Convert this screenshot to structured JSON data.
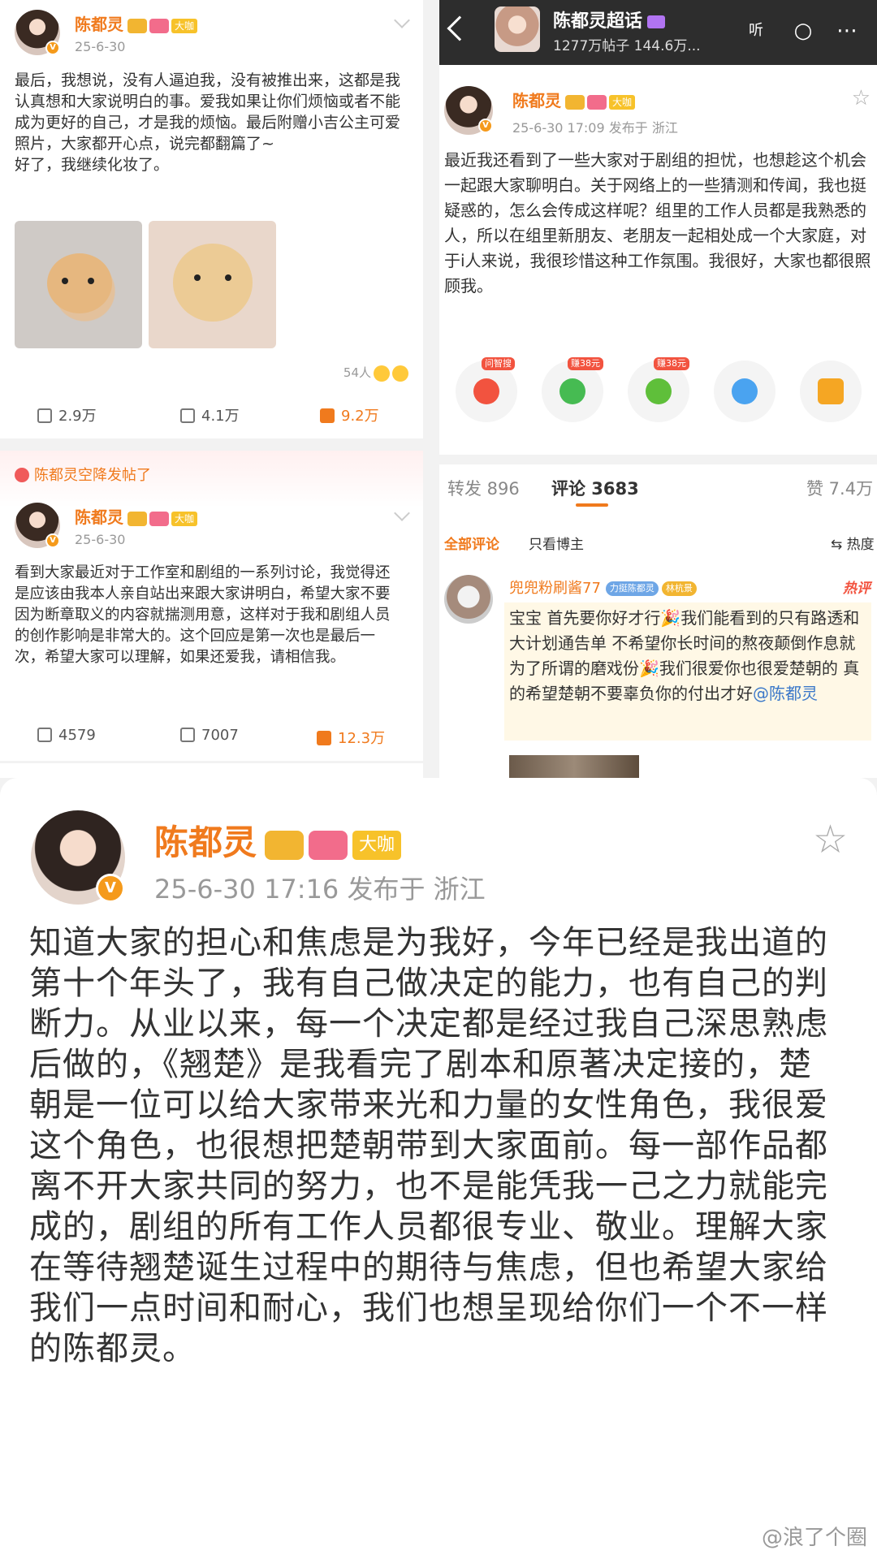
{
  "left": {
    "post1": {
      "username": "陈都灵",
      "level_badge": "大咖",
      "date": "25-6-30",
      "text": "最后，我想说，没有人逼迫我，没有被推出来，这都是我认真想和大家说明白的事。爱我如果让你们烦恼或者不能成为更好的自己，才是我的烦恼。最后附赠小吉公主可爱照片，大家都开心点，说完都翻篇了~\n好了，我继续化妆了。",
      "likes_people": "54人",
      "repost": "2.9万",
      "comment": "4.1万",
      "like": "9.2万"
    },
    "post2": {
      "airdrop_label": "陈都灵空降发帖了",
      "username": "陈都灵",
      "level_badge": "大咖",
      "date": "25-6-30",
      "text": "看到大家最近对于工作室和剧组的一系列讨论，我觉得还是应该由我本人亲自站出来跟大家讲明白，希望大家不要因为断章取义的内容就揣测用意，这样对于我和剧组人员的创作影响是非常大的。这个回应是第一次也是最后一次，希望大家可以理解，如果还爱我，请相信我。",
      "repost": "4579",
      "comment": "7007",
      "like": "12.3万"
    }
  },
  "right": {
    "topbar": {
      "title": "陈都灵超话",
      "subtitle": "1277万帖子 144.6万...",
      "listen_icon": "听"
    },
    "post": {
      "username": "陈都灵",
      "level_badge": "大咖",
      "meta": "25-6-30 17:09  发布于 浙江",
      "text": "最近我还看到了一些大家对于剧组的担忧，也想趁这个机会一起跟大家聊明白。关于网络上的一些猜测和传闻，我也挺疑惑的，怎么会传成这样呢？组里的工作人员都是我熟悉的人，所以在组里新朋友、老朋友一起相处成一个大家庭，对于i人来说，我很珍惜这种工作氛围。我很好，大家也都很照顾我。"
    },
    "share_tags": [
      "问智搜",
      "赚38元",
      "赚38元"
    ],
    "tabs": {
      "repost": "转发 896",
      "comment": "评论 3683",
      "like": "赞 7.4万"
    },
    "filters": {
      "all": "全部评论",
      "owner_only": "只看博主",
      "sort": "热度"
    },
    "comment": {
      "username": "兜兜粉刷酱77",
      "badge1": "力挺陈都灵",
      "badge2": "林杭景",
      "hot_label": "热评",
      "text": "宝宝 首先要你好才行🎉我们能看到的只有路透和大计划通告单 不希望你长时间的熬夜颠倒作息就为了所谓的磨戏份🎉我们很爱你也很爱楚朝的 真的希望楚朝不要辜负你的付出才好",
      "mention": "@陈都灵"
    }
  },
  "bottom": {
    "username": "陈都灵",
    "level_badge": "大咖",
    "meta": "25-6-30 17:16  发布于 浙江",
    "text": "知道大家的担心和焦虑是为我好，今年已经是我出道的第十个年头了，我有自己做决定的能力，也有自己的判断力。从业以来，每一个决定都是经过我自己深思熟虑后做的，《翘楚》是我看完了剧本和原著决定接的，楚朝是一位可以给大家带来光和力量的女性角色，我很爱这个角色，也很想把楚朝带到大家面前。每一部作品都离不开大家共同的努力，也不是能凭我一己之力就能完成的，剧组的所有工作人员都很专业、敬业。理解大家在等待翘楚诞生过程中的期待与焦虑，但也希望大家给我们一点时间和耐心，我们也想呈现给你们一个不一样的陈都灵。",
    "watermark": "@浪了个圈"
  }
}
